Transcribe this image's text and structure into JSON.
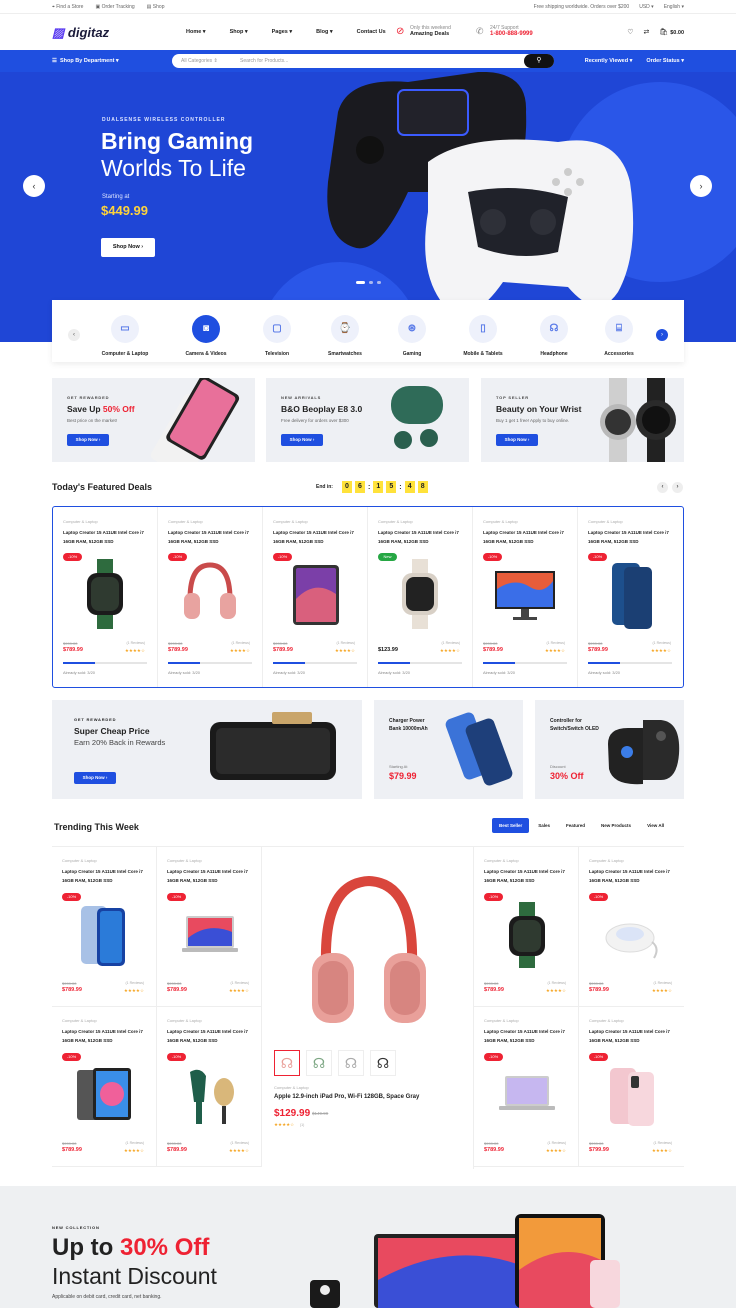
{
  "topbar": {
    "left": [
      "Find a Store",
      "Order Tracking",
      "Shop"
    ],
    "shipping": "Free shipping worldwide. Orders over $200",
    "currency": "USD",
    "language": "English"
  },
  "header": {
    "logo": "digitaz",
    "nav": [
      "Home",
      "Shop",
      "Pages",
      "Blog",
      "Contact Us"
    ],
    "deals_small": "Only this weekend",
    "deals": "Amazing Deals",
    "support_small": "24/7 Support",
    "support": "1-800-888-9999",
    "cart_total": "$0.00"
  },
  "bluebar": {
    "dept": "Shop By Department",
    "category": "All Categories",
    "search_placeholder": "Search for Products...",
    "recent": "Recently Viewed",
    "order": "Order Status"
  },
  "hero": {
    "kicker": "DUALSENSE WIRELESS CONTROLLER",
    "title1": "Bring Gaming",
    "title2": "Worlds To Life",
    "starting": "Starting at",
    "price": "$449.99",
    "button": "Shop Now"
  },
  "categories": [
    "Computer & Laptop",
    "Camera & Videos",
    "Television",
    "Smartwatches",
    "Gaming",
    "Mobile & Tablets",
    "Headphone",
    "Accessories"
  ],
  "promos": [
    {
      "kicker": "GET REWARDED",
      "title_a": "Save Up ",
      "title_b": "50% Off",
      "sub": "Best price on the market!",
      "button": "Shop Now"
    },
    {
      "kicker": "NEW ARRIVALS",
      "title_a": "B&O Beoplay E8 3.0",
      "title_b": "",
      "sub": "Free delivery for orders over $300",
      "button": "Shop Now"
    },
    {
      "kicker": "TOP SELLER",
      "title_a": "Beauty on Your Wrist",
      "title_b": "",
      "sub": "Buy 1 get 1 free! Apply to buy online.",
      "button": "Shop Now"
    }
  ],
  "featured": {
    "title": "Today's Featured Deals",
    "end_in": "End in:",
    "timer": [
      "0",
      "6",
      "1",
      "5",
      "4",
      "8"
    ]
  },
  "deal_cards": [
    {
      "cat": "Computer & Laptop",
      "name": "Laptop Creator 15 A11UE Intel Core i7 16GB RAM, 512GB SSD",
      "badge": "-10%",
      "old": "$999.00",
      "price": "$789.99",
      "reviews": "(1 Reviews)",
      "stars": "★★★★☆",
      "sold": "Already sold: 3/20"
    },
    {
      "cat": "Computer & Laptop",
      "name": "Laptop Creator 15 A11UE Intel Core i7 16GB RAM, 512GB SSD",
      "badge": "-10%",
      "old": "$999.00",
      "price": "$789.99",
      "reviews": "(1 Reviews)",
      "stars": "★★★★☆",
      "sold": "Already sold: 3/20"
    },
    {
      "cat": "Computer & Laptop",
      "name": "Laptop Creator 15 A11UE Intel Core i7 16GB RAM, 512GB SSD",
      "badge": "-10%",
      "old": "$999.00",
      "price": "$789.99",
      "reviews": "(1 Reviews)",
      "stars": "★★★★☆",
      "sold": "Already sold: 3/20"
    },
    {
      "cat": "Computer & Laptop",
      "name": "Laptop Creator 15 A11UE Intel Core i7 16GB RAM, 512GB SSD",
      "badge": "New",
      "old": "",
      "price": "$123.99",
      "reviews": "(1 Reviews)",
      "stars": "★★★★☆",
      "sold": "Already sold: 3/20"
    },
    {
      "cat": "Computer & Laptop",
      "name": "Laptop Creator 15 A11UE Intel Core i7 16GB RAM, 512GB SSD",
      "badge": "-10%",
      "old": "$999.00",
      "price": "$789.99",
      "reviews": "(1 Reviews)",
      "stars": "★★★★☆",
      "sold": "Already sold: 3/20"
    },
    {
      "cat": "Computer & Laptop",
      "name": "Laptop Creator 15 A11UE Intel Core i7 16GB RAM, 512GB SSD",
      "badge": "-10%",
      "old": "$999.00",
      "price": "$789.99",
      "reviews": "(1 Reviews)",
      "stars": "★★★★☆",
      "sold": "Already sold: 3/20"
    }
  ],
  "banner_row": {
    "a": {
      "kicker": "GET REWARDED",
      "title": "Super Cheap Price",
      "sub": "Earn 20% Back in Rewards",
      "button": "Shop Now"
    },
    "b": {
      "title1": "Charger Power",
      "title2": "Bank 10000mAh",
      "small": "Starting At",
      "price": "$79.99"
    },
    "c": {
      "title1": "Controller for",
      "title2": "Switch/Switch OLED",
      "small": "Discount",
      "price": "30% Off"
    }
  },
  "trending": {
    "title": "Trending This Week",
    "tabs": [
      "Best Seller",
      "Sales",
      "Featured",
      "New Products",
      "View All"
    ]
  },
  "trend_cards": [
    {
      "cat": "Computer & Laptop",
      "name": "Laptop Creator 15 A11UE Intel Core i7 16GB RAM, 512GB SSD",
      "badge": "-10%",
      "old": "$999.00",
      "price": "$789.99",
      "reviews": "(1 Reviews)",
      "stars": "★★★★☆"
    },
    {
      "cat": "Computer & Laptop",
      "name": "Laptop Creator 15 A11UE Intel Core i7 16GB RAM, 512GB SSD",
      "badge": "-10%",
      "old": "$999.00",
      "price": "$789.99",
      "reviews": "(1 Reviews)",
      "stars": "★★★★☆"
    },
    {
      "cat": "Computer & Laptop",
      "name": "Laptop Creator 15 A11UE Intel Core i7 16GB RAM, 512GB SSD",
      "badge": "-10%",
      "old": "$999.00",
      "price": "$789.99",
      "reviews": "(1 Reviews)",
      "stars": "★★★★☆"
    },
    {
      "cat": "Computer & Laptop",
      "name": "Laptop Creator 15 A11UE Intel Core i7 16GB RAM, 512GB SSD",
      "badge": "-10%",
      "old": "$999.00",
      "price": "$789.99",
      "reviews": "(1 Reviews)",
      "stars": "★★★★☆"
    },
    {
      "cat": "Computer & Laptop",
      "name": "Laptop Creator 15 A11UE Intel Core i7 16GB RAM, 512GB SSD",
      "badge": "-10%",
      "old": "$999.00",
      "price": "$789.99",
      "reviews": "(1 Reviews)",
      "stars": "★★★★☆"
    },
    {
      "cat": "Computer & Laptop",
      "name": "Laptop Creator 15 A11UE Intel Core i7 16GB RAM, 512GB SSD",
      "badge": "-10%",
      "old": "$999.00",
      "price": "$789.99",
      "reviews": "(1 Reviews)",
      "stars": "★★★★☆"
    },
    {
      "cat": "Computer & Laptop",
      "name": "Laptop Creator 15 A11UE Intel Core i7 16GB RAM, 512GB SSD",
      "badge": "-10%",
      "old": "$999.00",
      "price": "$789.99",
      "reviews": "(1 Reviews)",
      "stars": "★★★★☆"
    },
    {
      "cat": "Computer & Laptop",
      "name": "Laptop Creator 15 A11UE Intel Core i7 16GB RAM, 512GB SSD",
      "badge": "-10%",
      "old": "$999.00",
      "price": "$799.99",
      "reviews": "(1 Reviews)",
      "stars": "★★★★☆"
    }
  ],
  "feature_product": {
    "cat": "Computer & Laptop",
    "name": "Apple 12.9-inch iPad Pro, Wi-Fi 128GB, Space Gray",
    "price": "$129.99",
    "old": "$149.99",
    "stars": "★★★★☆",
    "reviews": "(1)"
  },
  "bottom": {
    "kicker": "NEW COLLECTION",
    "title_a": "Up to ",
    "title_b": "30% Off",
    "title2": "Instant Discount",
    "sub": "Applicable on debit card, credit card, net banking."
  },
  "colors": {
    "brand_blue": "#1f4fe0",
    "sale_red": "#ee2233",
    "timer_yellow": "#ffe23b"
  }
}
